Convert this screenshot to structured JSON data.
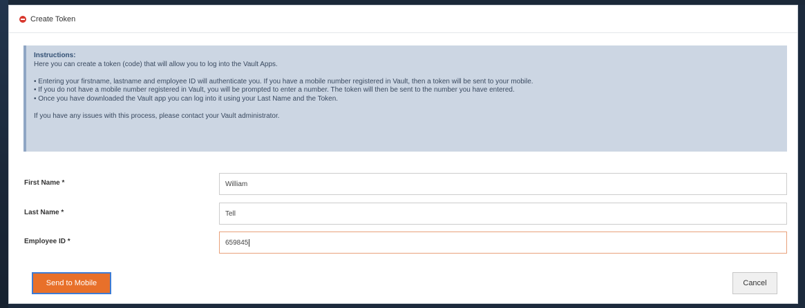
{
  "dialog": {
    "title": "Create Token",
    "title_icon": "stop-icon"
  },
  "instructions": {
    "heading": "Instructions:",
    "intro": "Here you can create a token (code) that will allow you to log into the Vault Apps.",
    "bullets": [
      "• Entering your firstname, lastname and employee ID will authenticate you. If you have a mobile number registered in Vault, then a token will be sent to your mobile.",
      "• If you do not have a mobile number registered in Vault, you will be prompted to enter a number. The token will then be sent to the number you have entered.",
      "• Once you have downloaded the Vault app you can log into it using your Last Name and the Token."
    ],
    "footer": "If you have any issues with this process, please contact your Vault administrator."
  },
  "form": {
    "first_name": {
      "label": "First Name *",
      "value": "William"
    },
    "last_name": {
      "label": "Last Name *",
      "value": "Tell"
    },
    "employee_id": {
      "label": "Employee ID *",
      "value": "659845"
    }
  },
  "buttons": {
    "send_label": "Send to Mobile",
    "cancel_label": "Cancel"
  },
  "colors": {
    "primary_button": "#e8702a",
    "instructions_bg": "#ccd6e3",
    "header_icon": "#d8382e"
  }
}
